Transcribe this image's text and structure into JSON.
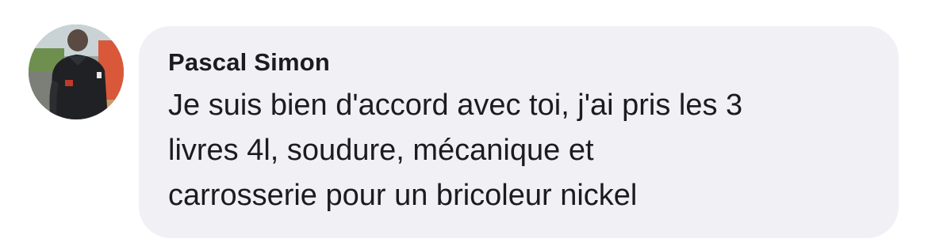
{
  "comment": {
    "author": "Pascal Simon",
    "text": "Je suis bien d'accord avec toi, j'ai pris les 3\nlivres 4l, soudure, mécanique et\ncarrosserie pour un bricoleur nickel",
    "bubble_color": "#f0f0f5",
    "text_color": "#1c1c1e"
  }
}
